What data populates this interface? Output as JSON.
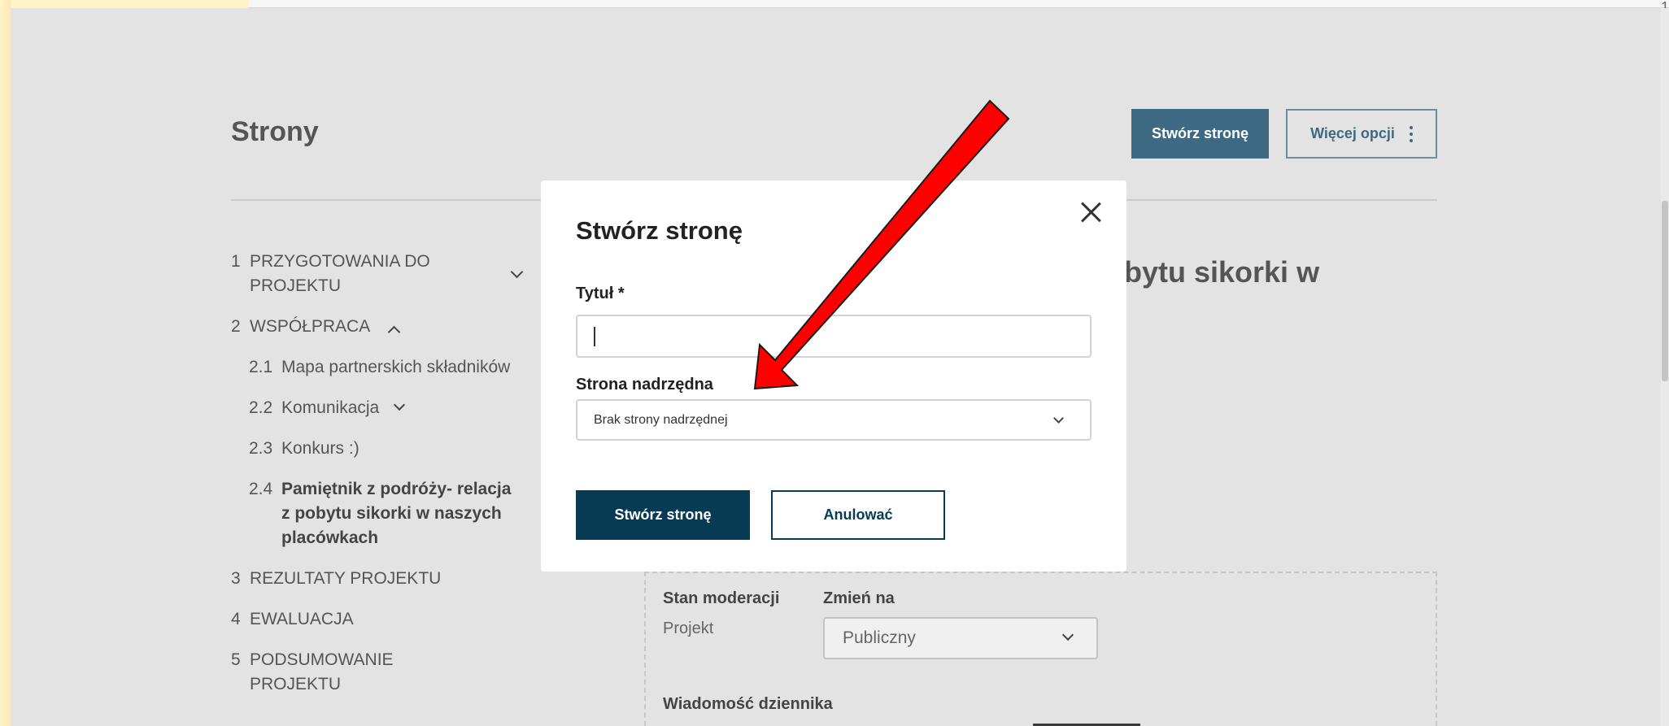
{
  "corner_mark": "1",
  "page": {
    "title": "Strony",
    "create_button": "Stwórz stronę",
    "more_options_button": "Więcej opcji"
  },
  "nav": {
    "items": [
      {
        "num": "1",
        "label": "PRZYGOTOWANIA DO",
        "label2": "PROJEKTU",
        "chevron": "chevron-down-icon"
      },
      {
        "num": "2",
        "label": "WSPÓŁPRACA",
        "chevron": "chevron-up-icon"
      },
      {
        "num": "2.1",
        "label": "Mapa partnerskich składników"
      },
      {
        "num": "2.2",
        "label": "Komunikacja",
        "chevron": "chevron-down-icon"
      },
      {
        "num": "2.3",
        "label": "Konkurs :)"
      },
      {
        "num": "2.4",
        "label": "Pamiętnik z podróży- relacja",
        "label2": "z pobytu sikorki w naszych",
        "label3": "placówkach",
        "active": true
      },
      {
        "num": "3",
        "label": "REZULTATY PROJEKTU"
      },
      {
        "num": "4",
        "label": "EWALUACJA"
      },
      {
        "num": "5",
        "label": "PODSUMOWANIE",
        "label2": "PROJEKTU"
      }
    ]
  },
  "background": {
    "heading_fragment": "bytu sikorki w",
    "moderation": {
      "state_label": "Stan moderacji",
      "state_value": "Projekt",
      "change_label": "Zmień na",
      "change_value": "Publiczny",
      "log_label": "Wiadomość dziennika"
    }
  },
  "modal": {
    "title": "Stwórz stronę",
    "title_field_label": "Tytuł *",
    "title_field_value": "",
    "parent_field_label": "Strona nadrzędna",
    "parent_field_value": "Brak strony nadrzędnej",
    "submit_button": "Stwórz stronę",
    "cancel_button": "Anulować"
  },
  "colors": {
    "accent": "#3d6a82",
    "primary_dark": "#073b54",
    "annotation_arrow": "#ff0000"
  }
}
